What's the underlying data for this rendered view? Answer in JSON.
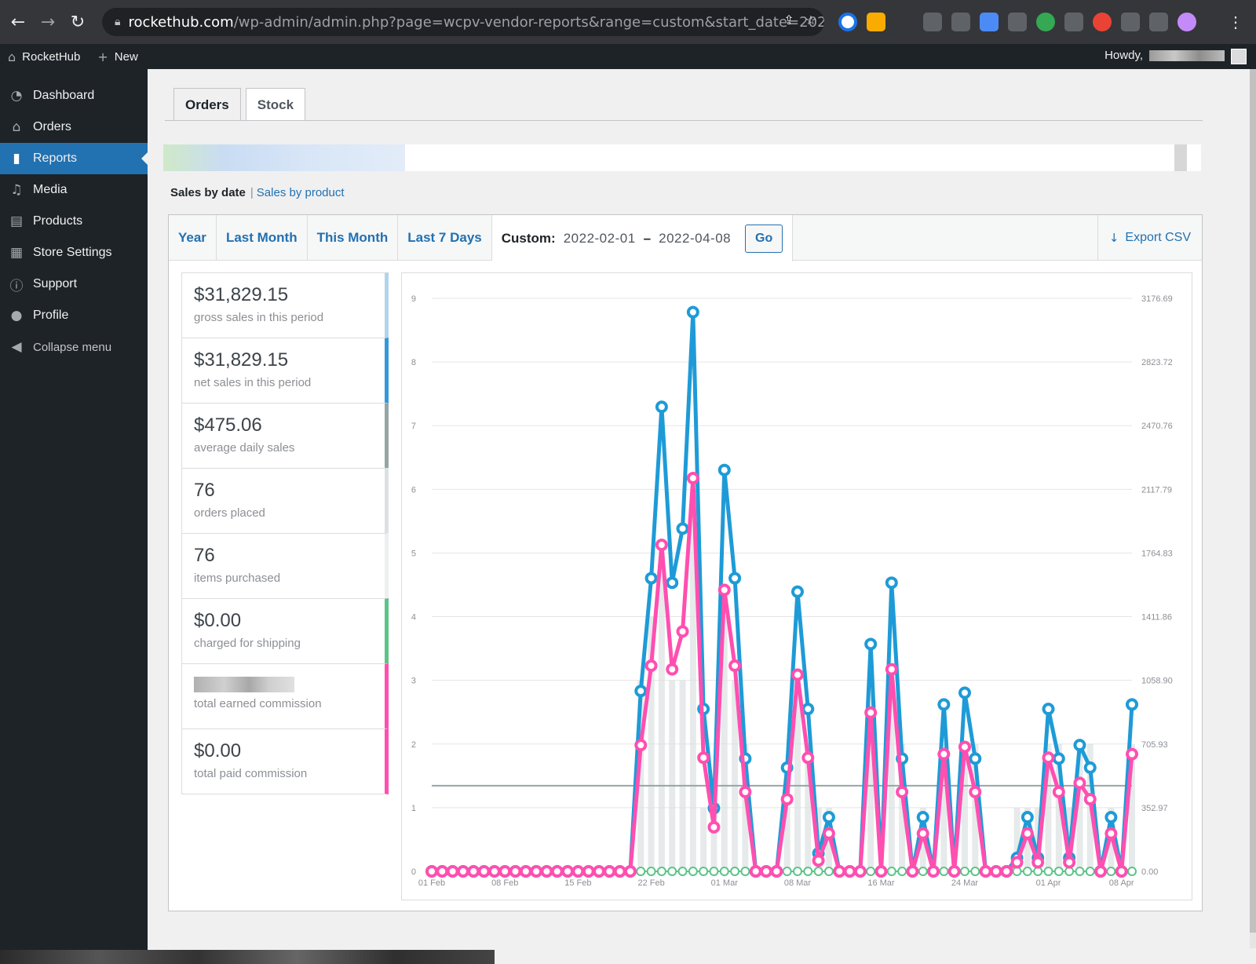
{
  "browser": {
    "url_host": "rockethub.com",
    "url_path": "/wp-admin/admin.php?page=wcpv-vendor-reports&range=custom&start_date=2022..."
  },
  "admin_bar": {
    "site_name": "RocketHub",
    "new_label": "New",
    "howdy": "Howdy,"
  },
  "menu": {
    "items": [
      {
        "label": "Dashboard",
        "icon": "dashboard-icon"
      },
      {
        "label": "Orders",
        "icon": "store-icon"
      },
      {
        "label": "Reports",
        "icon": "chart-bar-icon"
      },
      {
        "label": "Media",
        "icon": "media-icon"
      },
      {
        "label": "Products",
        "icon": "archive-icon"
      },
      {
        "label": "Store Settings",
        "icon": "settings-icon"
      },
      {
        "label": "Support",
        "icon": "info-icon"
      },
      {
        "label": "Profile",
        "icon": "user-icon"
      }
    ],
    "collapse_label": "Collapse menu",
    "active_index": 2
  },
  "tabs": [
    "Orders",
    "Stock"
  ],
  "subsub": {
    "current": "Sales by date",
    "other": "Sales by product"
  },
  "ranges": [
    "Year",
    "Last Month",
    "This Month",
    "Last 7 Days"
  ],
  "custom": {
    "label": "Custom:",
    "start": "2022-02-01",
    "dash": "–",
    "end": "2022-04-08",
    "go": "Go"
  },
  "export_label": "Export CSV",
  "legend": [
    {
      "amount": "$31,829.15",
      "desc": "gross sales in this period",
      "color": "#b1d4ea"
    },
    {
      "amount": "$31,829.15",
      "desc": "net sales in this period",
      "color": "#3498db"
    },
    {
      "amount": "$475.06",
      "desc": "average daily sales",
      "color": "#95a5a6"
    },
    {
      "amount": "76",
      "desc": "orders placed",
      "color": "#dbe1e3"
    },
    {
      "amount": "76",
      "desc": "items purchased",
      "color": "#ecf0f1"
    },
    {
      "amount": "$0.00",
      "desc": "charged for shipping",
      "color": "#5cc488"
    },
    {
      "amount": "",
      "desc": "total earned commission",
      "color": "#ff4fb0"
    },
    {
      "amount": "$0.00",
      "desc": "total paid commission",
      "color": "#ff4fb0"
    }
  ],
  "chart_data": {
    "type": "line",
    "x_tick_labels": [
      "01 Feb",
      "08 Feb",
      "15 Feb",
      "22 Feb",
      "01 Mar",
      "08 Mar",
      "16 Mar",
      "24 Mar",
      "01 Apr",
      "08 Apr"
    ],
    "x_tick_day_index": [
      0,
      7,
      14,
      21,
      28,
      35,
      43,
      51,
      59,
      66
    ],
    "y_left_ticks": [
      "0",
      "1",
      "2",
      "3",
      "4",
      "5",
      "6",
      "7",
      "8",
      "9"
    ],
    "y_left_range": [
      0,
      9
    ],
    "y_right_ticks": [
      "0.00",
      "352.97",
      "705.93",
      "1058.90",
      "1411.86",
      "1764.83",
      "2117.79",
      "2470.76",
      "2823.72",
      "3176.69"
    ],
    "y_right_range": [
      0,
      3176.69
    ],
    "average_daily_sales": 475.06,
    "series": [
      {
        "name": "net sales in this period",
        "color": "#1e9bd7",
        "axis": "right",
        "values": [
          0,
          0,
          0,
          0,
          0,
          0,
          0,
          0,
          0,
          0,
          0,
          0,
          0,
          0,
          0,
          0,
          0,
          0,
          0,
          0,
          1000,
          1625,
          2575,
          1600,
          1900,
          3100,
          900,
          350,
          2225,
          1625,
          625,
          0,
          0,
          0,
          575,
          1550,
          900,
          100,
          300,
          0,
          0,
          0,
          1260,
          0,
          1600,
          625,
          0,
          300,
          0,
          925,
          0,
          990,
          625,
          0,
          0,
          0,
          75,
          300,
          75,
          900,
          625,
          75,
          700,
          575,
          0,
          300,
          0,
          925
        ]
      },
      {
        "name": "total earned commission",
        "color": "#ff4fb0",
        "axis": "right",
        "values": [
          0,
          0,
          0,
          0,
          0,
          0,
          0,
          0,
          0,
          0,
          0,
          0,
          0,
          0,
          0,
          0,
          0,
          0,
          0,
          0,
          700,
          1140,
          1810,
          1120,
          1330,
          2180,
          630,
          245,
          1560,
          1140,
          440,
          0,
          0,
          0,
          400,
          1090,
          630,
          60,
          210,
          0,
          0,
          0,
          880,
          0,
          1120,
          440,
          0,
          210,
          0,
          650,
          0,
          690,
          440,
          0,
          0,
          0,
          50,
          210,
          50,
          630,
          440,
          50,
          490,
          400,
          0,
          210,
          0,
          650
        ]
      },
      {
        "name": "charged for shipping",
        "color": "#5cc488",
        "axis": "right",
        "values": [
          0,
          0,
          0,
          0,
          0,
          0,
          0,
          0,
          0,
          0,
          0,
          0,
          0,
          0,
          0,
          0,
          0,
          0,
          0,
          0,
          0,
          0,
          0,
          0,
          0,
          0,
          0,
          0,
          0,
          0,
          0,
          0,
          0,
          0,
          0,
          0,
          0,
          0,
          0,
          0,
          0,
          0,
          0,
          0,
          0,
          0,
          0,
          0,
          0,
          0,
          0,
          0,
          0,
          0,
          0,
          0,
          0,
          0,
          0,
          0,
          0,
          0,
          0,
          0,
          0,
          0,
          0,
          0
        ]
      },
      {
        "name": "orders placed",
        "color": "#dbe1e3",
        "axis": "left",
        "type": "bar",
        "values": [
          0,
          0,
          0,
          0,
          0,
          0,
          0,
          0,
          0,
          0,
          0,
          0,
          0,
          0,
          0,
          0,
          0,
          0,
          0,
          0,
          3,
          4,
          5,
          3,
          3,
          6,
          1,
          1,
          4,
          3,
          2,
          0,
          0,
          0,
          1,
          3,
          2,
          1,
          1,
          0,
          0,
          0,
          3,
          0,
          3,
          2,
          0,
          1,
          0,
          2,
          0,
          2,
          2,
          0,
          0,
          0,
          1,
          1,
          1,
          2,
          2,
          1,
          2,
          2,
          0,
          1,
          0,
          2
        ]
      }
    ]
  }
}
